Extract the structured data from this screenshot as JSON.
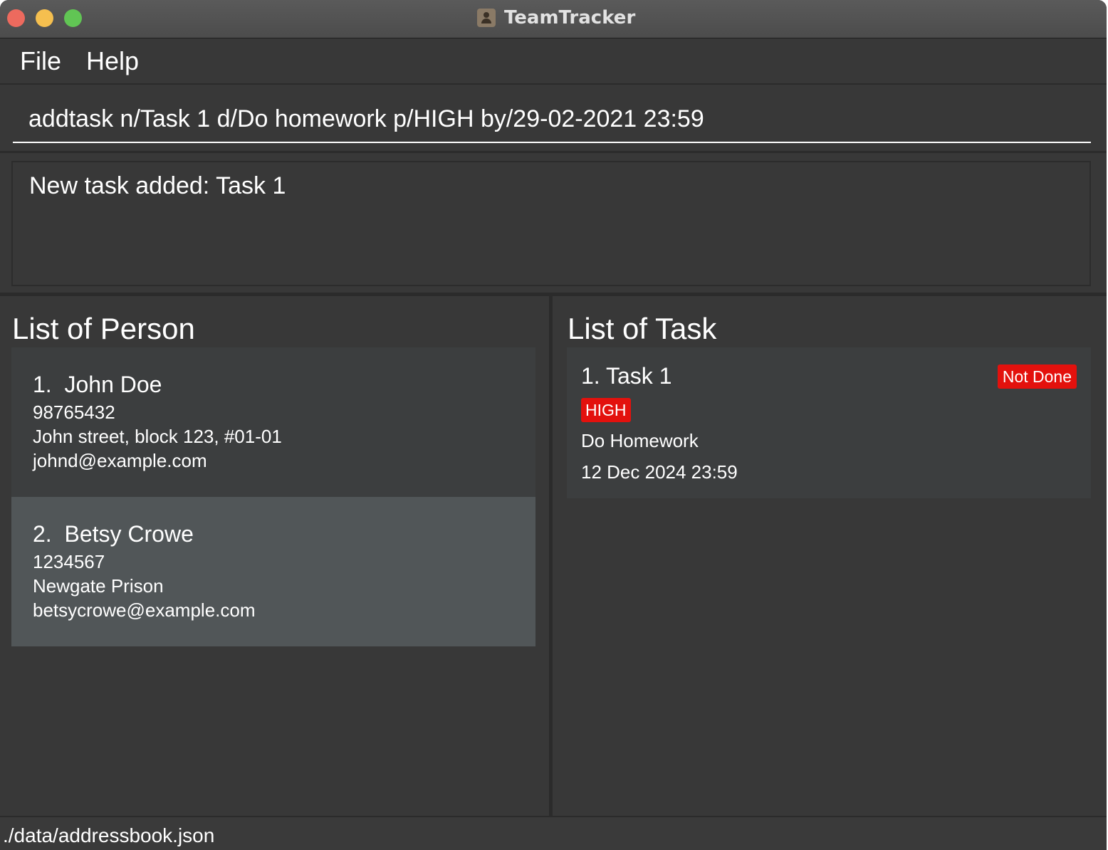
{
  "window": {
    "title": "TeamTracker"
  },
  "menu": {
    "items": [
      {
        "label": "File"
      },
      {
        "label": "Help"
      }
    ]
  },
  "command": {
    "value": "addtask n/Task 1 d/Do homework p/HIGH by/29-02-2021 23:59"
  },
  "result": {
    "message": "New task added: Task 1"
  },
  "person_panel": {
    "title": "List of Person",
    "persons": [
      {
        "name": "1.  John Doe",
        "phone": "98765432",
        "address": "John street, block 123, #01-01",
        "email": "johnd@example.com"
      },
      {
        "name": "2.  Betsy Crowe",
        "phone": "1234567",
        "address": "Newgate Prison",
        "email": "betsycrowe@example.com"
      }
    ]
  },
  "task_panel": {
    "title": "List of Task",
    "tasks": [
      {
        "name": "1. Task 1",
        "status": "Not Done",
        "priority": "HIGH",
        "description": "Do Homework",
        "deadline": "12 Dec 2024 23:59"
      }
    ]
  },
  "status_bar": {
    "path": "./data/addressbook.json"
  },
  "colors": {
    "background": "#383838",
    "badge_red": "#e3110d",
    "selected_card": "#515658"
  }
}
